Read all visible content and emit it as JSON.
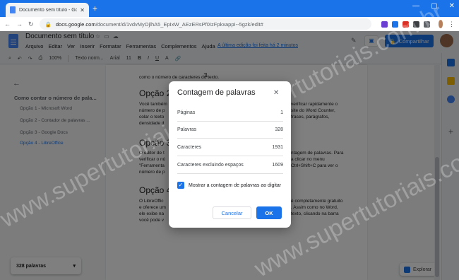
{
  "browser": {
    "tab_title": "Documento sem título - Google D",
    "tab_close": "✕",
    "new_tab": "+",
    "window_controls": [
      "—",
      "▢",
      "✕"
    ],
    "url_host": "docs.google.com",
    "url_path": "/document/d/1vdvMyOjlhA5_EpIxW_AEzERsPf0IzFpkxappI--5gzk/edit#"
  },
  "docs": {
    "title": "Documento sem título",
    "menu": [
      "Arquivo",
      "Editar",
      "Ver",
      "Inserir",
      "Formatar",
      "Ferramentas",
      "Complementos",
      "Ajuda"
    ],
    "last_edit": "A última edição foi feita há 2 minutos",
    "share_label": "Compartilhar",
    "format_bar": {
      "zoom": "100%",
      "style": "Texto norm...",
      "font": "Arial",
      "size": "11"
    }
  },
  "outline": {
    "heading": "Como contar o número de pala...",
    "items": [
      "Opção 1 - Microsoft Word",
      "Opção 2 - Contador de palavras ...",
      "Opção 3 - Google Docs",
      "Opção 4 - LibreOffice"
    ],
    "word_count": "328 palavras"
  },
  "page": {
    "line_top": "como o número de caracteres do texto.",
    "h_opcao2": "Opção 2",
    "p_opcao2_a": "Você também",
    "p_opcao2_b": "número de p",
    "p_opcao2_c": "colar o texto",
    "p_opcao2_d": "densidade d",
    "p_opcao2_r1": "verificar rapidamente o",
    "p_opcao2_r2": "site do Word Counter,",
    "p_opcao2_r3": "frases, parágrafos,",
    "h_opcao3": "Opção 3",
    "p_opcao3_a": "O editor de t",
    "p_opcao3_b": "verificar o nú",
    "p_opcao3_c": "\"Ferramenta",
    "p_opcao3_d": "número de p",
    "p_opcao3_r1": "ntagem de palavras. Para",
    "p_opcao3_r2": "a clicar no menu",
    "p_opcao3_r3": "Ctrl+Shift+C para ver o",
    "h_opcao4": "Opção 4",
    "p_opcao4_a": "O LibreOffic",
    "p_opcao4_b": "e oferece um",
    "p_opcao4_c": "ele exibe na",
    "p_opcao4_d": "você pode v",
    "p_opcao4_r1": "é completamente gratuito",
    "p_opcao4_r2": ". Assim como no Word,",
    "p_opcao4_r3": "texto, clicando na barra",
    "explore": "Explorar"
  },
  "dialog": {
    "title": "Contagem de palavras",
    "close": "✕",
    "rows": [
      {
        "label": "Páginas",
        "value": "1"
      },
      {
        "label": "Palavras",
        "value": "328"
      },
      {
        "label": "Caracteres",
        "value": "1931"
      },
      {
        "label": "Caracteres excluindo espaços",
        "value": "1609"
      }
    ],
    "checkbox_label": "Mostrar a contagem de palavras ao digitar",
    "checkbox_checked": true,
    "cancel_label": "Cancelar",
    "ok_label": "OK"
  },
  "watermark": "www.supertutoriais.com.br",
  "colors": {
    "accent": "#1a73e8",
    "scrim": "rgba(0,0,0,0.5)"
  }
}
